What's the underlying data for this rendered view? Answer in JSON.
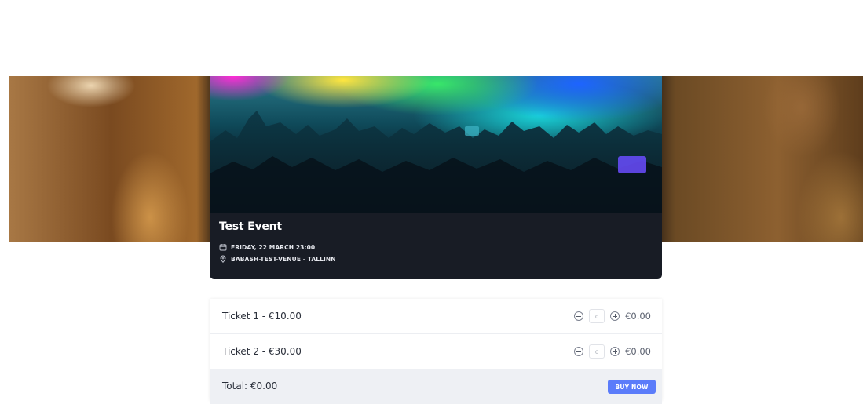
{
  "event": {
    "title": "Test Event",
    "date": "FRIDAY, 22 MARCH 23:00",
    "venue": "BABASH-TEST-VENUE - TALLINN"
  },
  "tickets": [
    {
      "name": "Ticket 1 - €10.00",
      "quantity": "0",
      "line_total": "€0.00"
    },
    {
      "name": "Ticket 2 - €30.00",
      "quantity": "0",
      "line_total": "€0.00"
    }
  ],
  "summary": {
    "total": "Total: €0.00",
    "buy_label": "BUY NOW"
  },
  "colors": {
    "card_bg": "#181c25",
    "accent": "#5b7cfa",
    "summary_bg": "#eef0f4"
  },
  "icons": {
    "date": "calendar-icon",
    "venue": "location-pin-icon",
    "decrease": "minus-circle-icon",
    "increase": "plus-circle-icon"
  }
}
